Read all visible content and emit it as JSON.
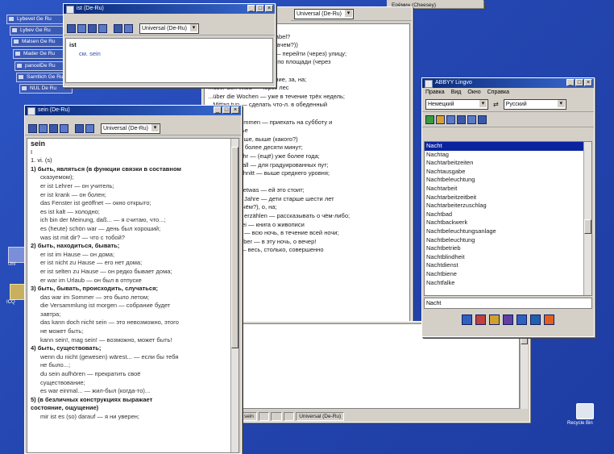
{
  "desktop": {
    "colors": {
      "background": "#2446b0"
    },
    "icons": [
      {
        "name": "recycle-bin",
        "label": "Recycle Bin"
      },
      {
        "name": "left-icon-1",
        "label": "Uni"
      },
      {
        "name": "left-icon-2",
        "label": "ICQ"
      }
    ]
  },
  "stacked_windows": [
    "Lybevel Ge Ru",
    "Lybev Ge Ru",
    "Malsen Ge Ru",
    "Mader Ge Ru",
    "sein Ge Ru",
    "pancelDe Ru",
    "Samtlich Ge Ru",
    "NUL De Ru"
  ],
  "top_window": {
    "title": "ist (De-Ru)",
    "dictionary_select": "Universal (De-Ru)",
    "content": [
      "ist",
      "см. sein"
    ]
  },
  "middle_window": {
    "dictionary_select": "Universal (De-Ru)",
    "status": [
      "sein",
      "Universal (De-Ru)"
    ],
    "lines": [
      "...",
      "nner aufst, — на вопрос abel?",
      "",
      "...ein Weg (после 1. по (зачем?))",
      "...uber die Straße gehen — перейти (через) улицу;",
      "...en Platz gehen — идти по площади (через",
      "... площадь)",
      "...ber надо через, в течение, за, на;",
      "...über den Wald — через лес",
      "...über die Wochen — уже в течение трёх недель;",
      "...Mittag tun — сделать что-л. в обеденный",
      "...перерыв;",
      "...Sonntag kommen — приехать на субботу и",
      "...воскресенье",
      "...более, свыше, выше (какого?)",
      "...Stunden — более десяти минут;",
      "...über ein Jahr — (ещё) уже более года;",
      "...über den Ball — для градуированных пут;",
      "...im Durchschnitt — выше среднего уровня;",
      "...разве",
      "...über Ihr ist etwas — ей это стоит;",
      "...über sechs Jahre — дети старше шести лет",
      "...нему: о (о чём?), о, на;",
      "...über etwas erzählen — рассказывать о чём-либо;",
      "...über Malerei — книга о живописи",
      "",
      "...Nacht über — всю ночь, в течение всей ночи;",
      "...die Nacht über — в эту ночь, о вечер!",
      "",
      "...Jahr über — весь, столько, совершенно"
    ]
  },
  "main_window": {
    "title": "sein (De-Ru)",
    "dictionary_select": "Universal (De-Ru)",
    "lines": [
      {
        "t": "sein",
        "s": "ttl"
      },
      {
        "t": "I",
        "s": ""
      },
      {
        "t": "1. vi. (s)",
        "s": ""
      },
      {
        "t": "1) быть, являться (в функции связки в составном",
        "s": "b"
      },
      {
        "t": "сказуемом);",
        "s": "i1"
      },
      {
        "t": "er ist Lehrer — он учитель;",
        "s": "i1"
      },
      {
        "t": "er ist krank — он болен;",
        "s": "i1"
      },
      {
        "t": "das Fenster ist geöffnet — окно открыто;",
        "s": "i1"
      },
      {
        "t": "es ist kalt — холодно;",
        "s": "i1"
      },
      {
        "t": "ich bin der Meinung, daß... — я считаю, что...;",
        "s": "i1"
      },
      {
        "t": "es (heute) schön war — день был хороший;",
        "s": "i1"
      },
      {
        "t": "was ist mit dir? — что с тобой?",
        "s": "i1"
      },
      {
        "t": "2) быть, находиться, бывать;",
        "s": "b"
      },
      {
        "t": "er ist im Hause — он дома;",
        "s": "i1"
      },
      {
        "t": "er ist nicht zu Hause — его нет дома;",
        "s": "i1"
      },
      {
        "t": "er ist selten zu Hause — он редко бывает дома;",
        "s": "i1"
      },
      {
        "t": "er war im Urlaub — он был в отпуске",
        "s": "i1"
      },
      {
        "t": "3) быть, бывать, происходить, случаться;",
        "s": "b"
      },
      {
        "t": "das war im Sommer — это было летом;",
        "s": "i1"
      },
      {
        "t": "die Versammlung ist morgen — собрание будет",
        "s": "i1"
      },
      {
        "t": "завтра;",
        "s": "i1"
      },
      {
        "t": "das kann doch nicht sein — это невозможно, этого",
        "s": "i1"
      },
      {
        "t": "не может быть;",
        "s": "i1"
      },
      {
        "t": "kann sein!, mag sein! — возможно, может быть!",
        "s": "i1"
      },
      {
        "t": "4) быть, существовать;",
        "s": "b"
      },
      {
        "t": "wenn du nicht (gewesen) wärest... — если бы тебя",
        "s": "i1"
      },
      {
        "t": "не было...;",
        "s": "i1"
      },
      {
        "t": "du sein aufhören — прекратить своё",
        "s": "i1"
      },
      {
        "t": "существование;",
        "s": "i1"
      },
      {
        "t": "es war einmal... — жил-был (когда-то)...",
        "s": "i1"
      },
      {
        "t": "5) (в безличных конструкциях выражает",
        "s": "b"
      },
      {
        "t": "состояние, ощущение)",
        "s": "b"
      },
      {
        "t": "mir ist es (so) darauf — я ни уверен;",
        "s": "i1"
      }
    ]
  },
  "lookup_window": {
    "title": "ABBYY Lingvo",
    "menu": [
      "Правка",
      "Вид",
      "Окно",
      "Справка"
    ],
    "lang_from": "Немецкий",
    "lang_to": "Русский",
    "words": [
      "Nacht",
      "Nachtag",
      "Nachtarbeitzeiten",
      "Nachtausgabe",
      "Nachtbeleuchtung",
      "Nachtarbeit",
      "Nachtarbeitzeitbeit",
      "Nachtarbeiterzuschlag",
      "Nachtbad",
      "Nachtbackwerk",
      "Nachtbeleuchtungsanlage",
      "Nachtbeleuchtung",
      "Nachtbetrieb",
      "Nachtblindheit",
      "Nachtdienst",
      "Nachtbiene",
      "Nachtfalke"
    ],
    "search_value": "Nacht"
  },
  "taskbar_top": {
    "label": "Ерёмин (Cheesey)"
  }
}
